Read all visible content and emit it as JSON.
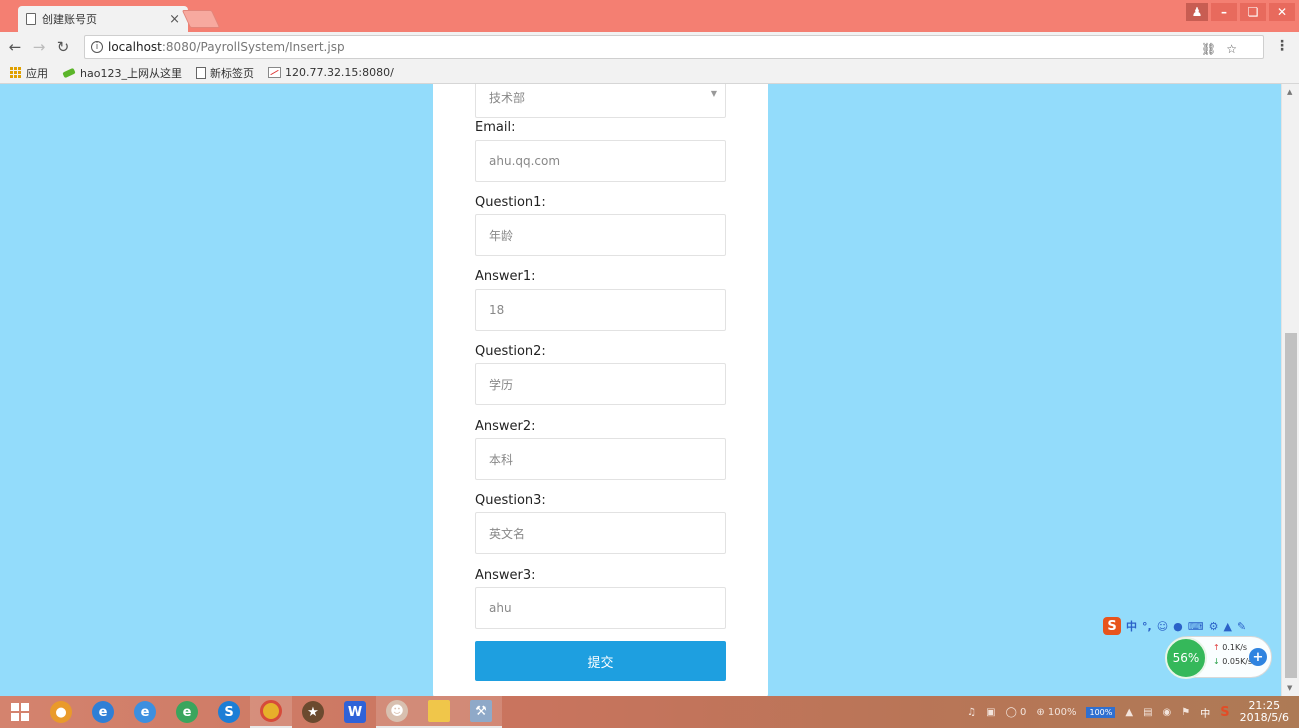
{
  "browser": {
    "tab_title": "创建账号页",
    "tab_close": "×",
    "url_host": "localhost",
    "url_path": ":8080/PayrollSystem/Insert.jsp",
    "bookmarks": [
      {
        "label": "应用",
        "icon": "apps-grid-icon"
      },
      {
        "label": "hao123_上网从这里",
        "icon": "hao123-icon"
      },
      {
        "label": "新标签页",
        "icon": "page-icon"
      },
      {
        "label": "120.77.32.15:8080/",
        "icon": "chart-icon"
      }
    ]
  },
  "form": {
    "department_value": "技术部",
    "fields": [
      {
        "label": "Email:",
        "value": "ahu.qq.com"
      },
      {
        "label": "Question1:",
        "value": "年龄"
      },
      {
        "label": "Answer1:",
        "value": "18"
      },
      {
        "label": "Question2:",
        "value": "学历"
      },
      {
        "label": "Answer2:",
        "value": "本科"
      },
      {
        "label": "Question3:",
        "value": "英文名"
      },
      {
        "label": "Answer3:",
        "value": "ahu"
      }
    ],
    "submit_label": "提交"
  },
  "widgets": {
    "ime_zh": "中",
    "ime_punct": "°,",
    "net_percent": "56%",
    "net_up": "0.1K/s",
    "net_down": "0.05K/s"
  },
  "taskbar": {
    "tray_zoom": "100%",
    "tray_count": "0",
    "battery": "100%",
    "lang": "中",
    "time": "21:25",
    "date": "2018/5/6"
  },
  "colors": {
    "titlebar": "#f47f72",
    "page_background": "#93dcfb",
    "submit_button": "#1e9fe0"
  }
}
